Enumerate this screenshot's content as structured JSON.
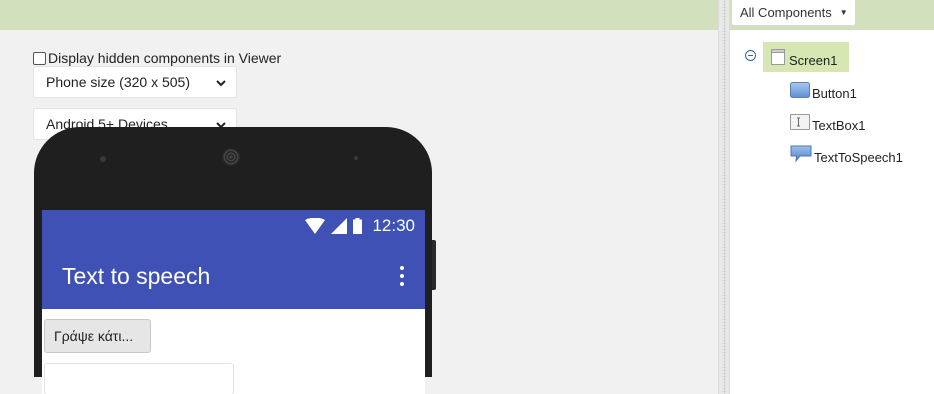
{
  "viewer": {
    "hidden_components_label": "Display hidden components in Viewer",
    "phone_size_selected": "Phone size (320 x 505)",
    "device_selected": "Android 5+ Devices"
  },
  "phone": {
    "status_time": "12:30",
    "app_title": "Text to speech",
    "button1_text": "Γράψε κάτι...",
    "textbox1_value": ""
  },
  "components": {
    "filter_label": "All Components",
    "root": {
      "label": "Screen1",
      "icon": "screen-icon"
    },
    "children": [
      {
        "label": "Button1",
        "icon": "button-icon"
      },
      {
        "label": "TextBox1",
        "icon": "textbox-icon"
      },
      {
        "label": "TextToSpeech1",
        "icon": "speech-bubble-icon"
      }
    ]
  },
  "colors": {
    "toolbar_green": "#d2e0bd",
    "selected_node": "#d6e7b4",
    "app_bar": "#3f51b5"
  }
}
